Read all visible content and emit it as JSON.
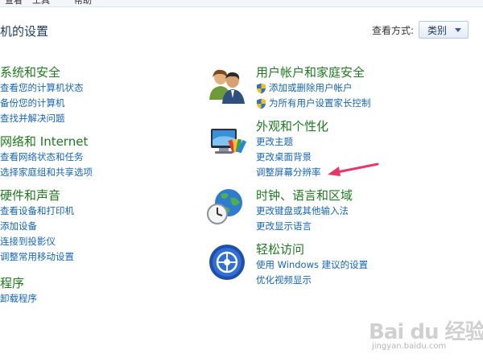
{
  "menubar": {
    "items": [
      "查看",
      "工具",
      "帮助"
    ]
  },
  "page_title": "机的设置",
  "view_by": {
    "label": "查看方式:",
    "value": "类别"
  },
  "left_categories": [
    {
      "title": "系统和安全",
      "links": [
        "查看您的计算机状态",
        "备份您的计算机",
        "查找并解决问题"
      ]
    },
    {
      "title": "网络和 Internet",
      "links": [
        "查看网络状态和任务",
        "选择家庭组和共享选项"
      ]
    },
    {
      "title": "硬件和声音",
      "links": [
        "查看设备和打印机",
        "添加设备",
        "连接到投影仪",
        "调整常用移动设置"
      ]
    },
    {
      "title": "程序",
      "links": [
        "卸载程序"
      ]
    }
  ],
  "right_categories": [
    {
      "title": "用户帐户和家庭安全",
      "icon": "users-icon",
      "links": [
        "添加或删除用户帐户",
        "为所有用户设置家长控制"
      ]
    },
    {
      "title": "外观和个性化",
      "icon": "appearance-icon",
      "links": [
        "更改主题",
        "更改桌面背景",
        "调整屏幕分辨率"
      ]
    },
    {
      "title": "时钟、语言和区域",
      "icon": "clock-globe-icon",
      "links": [
        "更改键盘或其他输入法",
        "更改显示语言"
      ]
    },
    {
      "title": "轻松访问",
      "icon": "ease-of-access-icon",
      "links": [
        "使用 Windows 建议的设置",
        "优化视频显示"
      ]
    }
  ],
  "annotation": {
    "color": "#e8366a"
  },
  "watermark": {
    "logo": "Bai du 经验",
    "url": "jingyan.baidu.com"
  },
  "colors": {
    "category_title": "#1e7a1e",
    "link": "#1665b4",
    "heading": "#1e395b"
  }
}
